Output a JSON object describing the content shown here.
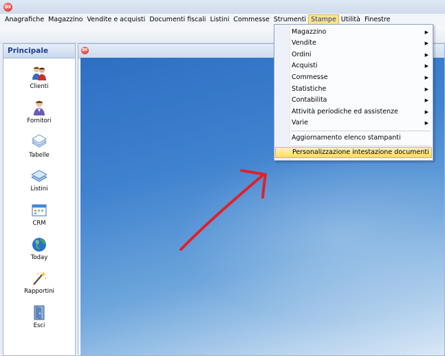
{
  "app": {
    "icon_text": "DX"
  },
  "menubar": {
    "items": [
      "Anagrafiche",
      "Magazzino",
      "Vendite e acquisti",
      "Documenti fiscali",
      "Listini",
      "Commesse",
      "Strumenti",
      "Stampe",
      "Utilità",
      "Finestre"
    ],
    "active": "Stampe"
  },
  "panel": {
    "title": "Principale",
    "items": [
      {
        "label": "Clienti",
        "icon": "clients-icon"
      },
      {
        "label": "Fornitori",
        "icon": "suppliers-icon"
      },
      {
        "label": "Tabelle",
        "icon": "tables-icon"
      },
      {
        "label": "Listini",
        "icon": "price-lists-icon"
      },
      {
        "label": "CRM",
        "icon": "crm-icon"
      },
      {
        "label": "Today",
        "icon": "globe-icon"
      },
      {
        "label": "Rapportini",
        "icon": "magic-wand-icon"
      },
      {
        "label": "Esci",
        "icon": "exit-door-icon"
      }
    ]
  },
  "stampe_menu": {
    "submenus": [
      "Magazzino",
      "Vendite",
      "Ordini",
      "Acquisti",
      "Commesse",
      "Statistiche",
      "Contabilita",
      "Attività periodiche ed assistenze",
      "Varie"
    ],
    "actions": [
      "Aggiornamento elenco stampanti",
      "Personalizzazione intestazione documenti"
    ],
    "highlighted": "Personalizzazione intestazione documenti"
  },
  "colors": {
    "accent_highlight": "#ffd968",
    "annotation_arrow": "#e0202a",
    "workspace_blue": "#3f82cf"
  }
}
